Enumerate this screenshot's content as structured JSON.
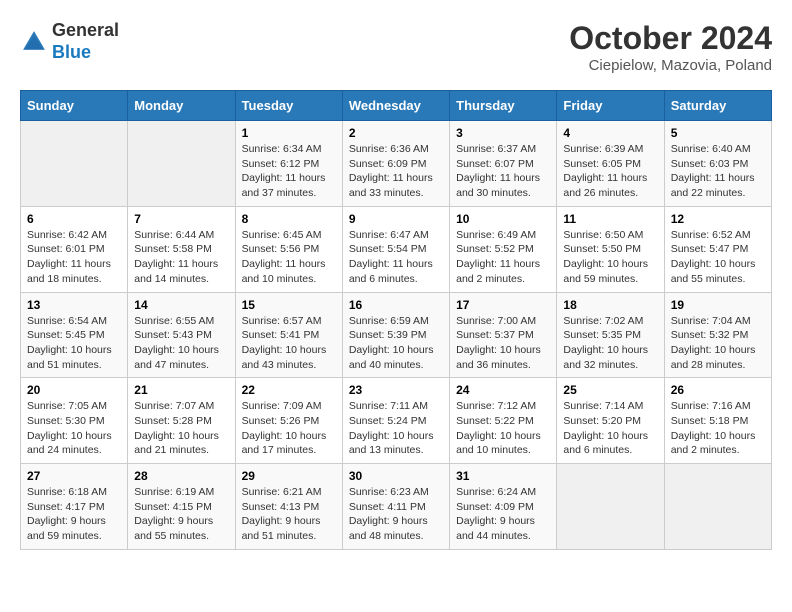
{
  "header": {
    "logo_general": "General",
    "logo_blue": "Blue",
    "month": "October 2024",
    "location": "Ciepielow, Mazovia, Poland"
  },
  "weekdays": [
    "Sunday",
    "Monday",
    "Tuesday",
    "Wednesday",
    "Thursday",
    "Friday",
    "Saturday"
  ],
  "weeks": [
    [
      {
        "day": "",
        "sunrise": "",
        "sunset": "",
        "daylight": "",
        "empty": true
      },
      {
        "day": "",
        "sunrise": "",
        "sunset": "",
        "daylight": "",
        "empty": true
      },
      {
        "day": "1",
        "sunrise": "Sunrise: 6:34 AM",
        "sunset": "Sunset: 6:12 PM",
        "daylight": "Daylight: 11 hours and 37 minutes."
      },
      {
        "day": "2",
        "sunrise": "Sunrise: 6:36 AM",
        "sunset": "Sunset: 6:09 PM",
        "daylight": "Daylight: 11 hours and 33 minutes."
      },
      {
        "day": "3",
        "sunrise": "Sunrise: 6:37 AM",
        "sunset": "Sunset: 6:07 PM",
        "daylight": "Daylight: 11 hours and 30 minutes."
      },
      {
        "day": "4",
        "sunrise": "Sunrise: 6:39 AM",
        "sunset": "Sunset: 6:05 PM",
        "daylight": "Daylight: 11 hours and 26 minutes."
      },
      {
        "day": "5",
        "sunrise": "Sunrise: 6:40 AM",
        "sunset": "Sunset: 6:03 PM",
        "daylight": "Daylight: 11 hours and 22 minutes."
      }
    ],
    [
      {
        "day": "6",
        "sunrise": "Sunrise: 6:42 AM",
        "sunset": "Sunset: 6:01 PM",
        "daylight": "Daylight: 11 hours and 18 minutes."
      },
      {
        "day": "7",
        "sunrise": "Sunrise: 6:44 AM",
        "sunset": "Sunset: 5:58 PM",
        "daylight": "Daylight: 11 hours and 14 minutes."
      },
      {
        "day": "8",
        "sunrise": "Sunrise: 6:45 AM",
        "sunset": "Sunset: 5:56 PM",
        "daylight": "Daylight: 11 hours and 10 minutes."
      },
      {
        "day": "9",
        "sunrise": "Sunrise: 6:47 AM",
        "sunset": "Sunset: 5:54 PM",
        "daylight": "Daylight: 11 hours and 6 minutes."
      },
      {
        "day": "10",
        "sunrise": "Sunrise: 6:49 AM",
        "sunset": "Sunset: 5:52 PM",
        "daylight": "Daylight: 11 hours and 2 minutes."
      },
      {
        "day": "11",
        "sunrise": "Sunrise: 6:50 AM",
        "sunset": "Sunset: 5:50 PM",
        "daylight": "Daylight: 10 hours and 59 minutes."
      },
      {
        "day": "12",
        "sunrise": "Sunrise: 6:52 AM",
        "sunset": "Sunset: 5:47 PM",
        "daylight": "Daylight: 10 hours and 55 minutes."
      }
    ],
    [
      {
        "day": "13",
        "sunrise": "Sunrise: 6:54 AM",
        "sunset": "Sunset: 5:45 PM",
        "daylight": "Daylight: 10 hours and 51 minutes."
      },
      {
        "day": "14",
        "sunrise": "Sunrise: 6:55 AM",
        "sunset": "Sunset: 5:43 PM",
        "daylight": "Daylight: 10 hours and 47 minutes."
      },
      {
        "day": "15",
        "sunrise": "Sunrise: 6:57 AM",
        "sunset": "Sunset: 5:41 PM",
        "daylight": "Daylight: 10 hours and 43 minutes."
      },
      {
        "day": "16",
        "sunrise": "Sunrise: 6:59 AM",
        "sunset": "Sunset: 5:39 PM",
        "daylight": "Daylight: 10 hours and 40 minutes."
      },
      {
        "day": "17",
        "sunrise": "Sunrise: 7:00 AM",
        "sunset": "Sunset: 5:37 PM",
        "daylight": "Daylight: 10 hours and 36 minutes."
      },
      {
        "day": "18",
        "sunrise": "Sunrise: 7:02 AM",
        "sunset": "Sunset: 5:35 PM",
        "daylight": "Daylight: 10 hours and 32 minutes."
      },
      {
        "day": "19",
        "sunrise": "Sunrise: 7:04 AM",
        "sunset": "Sunset: 5:32 PM",
        "daylight": "Daylight: 10 hours and 28 minutes."
      }
    ],
    [
      {
        "day": "20",
        "sunrise": "Sunrise: 7:05 AM",
        "sunset": "Sunset: 5:30 PM",
        "daylight": "Daylight: 10 hours and 24 minutes."
      },
      {
        "day": "21",
        "sunrise": "Sunrise: 7:07 AM",
        "sunset": "Sunset: 5:28 PM",
        "daylight": "Daylight: 10 hours and 21 minutes."
      },
      {
        "day": "22",
        "sunrise": "Sunrise: 7:09 AM",
        "sunset": "Sunset: 5:26 PM",
        "daylight": "Daylight: 10 hours and 17 minutes."
      },
      {
        "day": "23",
        "sunrise": "Sunrise: 7:11 AM",
        "sunset": "Sunset: 5:24 PM",
        "daylight": "Daylight: 10 hours and 13 minutes."
      },
      {
        "day": "24",
        "sunrise": "Sunrise: 7:12 AM",
        "sunset": "Sunset: 5:22 PM",
        "daylight": "Daylight: 10 hours and 10 minutes."
      },
      {
        "day": "25",
        "sunrise": "Sunrise: 7:14 AM",
        "sunset": "Sunset: 5:20 PM",
        "daylight": "Daylight: 10 hours and 6 minutes."
      },
      {
        "day": "26",
        "sunrise": "Sunrise: 7:16 AM",
        "sunset": "Sunset: 5:18 PM",
        "daylight": "Daylight: 10 hours and 2 minutes."
      }
    ],
    [
      {
        "day": "27",
        "sunrise": "Sunrise: 6:18 AM",
        "sunset": "Sunset: 4:17 PM",
        "daylight": "Daylight: 9 hours and 59 minutes."
      },
      {
        "day": "28",
        "sunrise": "Sunrise: 6:19 AM",
        "sunset": "Sunset: 4:15 PM",
        "daylight": "Daylight: 9 hours and 55 minutes."
      },
      {
        "day": "29",
        "sunrise": "Sunrise: 6:21 AM",
        "sunset": "Sunset: 4:13 PM",
        "daylight": "Daylight: 9 hours and 51 minutes."
      },
      {
        "day": "30",
        "sunrise": "Sunrise: 6:23 AM",
        "sunset": "Sunset: 4:11 PM",
        "daylight": "Daylight: 9 hours and 48 minutes."
      },
      {
        "day": "31",
        "sunrise": "Sunrise: 6:24 AM",
        "sunset": "Sunset: 4:09 PM",
        "daylight": "Daylight: 9 hours and 44 minutes."
      },
      {
        "day": "",
        "sunrise": "",
        "sunset": "",
        "daylight": "",
        "empty": true
      },
      {
        "day": "",
        "sunrise": "",
        "sunset": "",
        "daylight": "",
        "empty": true
      }
    ]
  ]
}
